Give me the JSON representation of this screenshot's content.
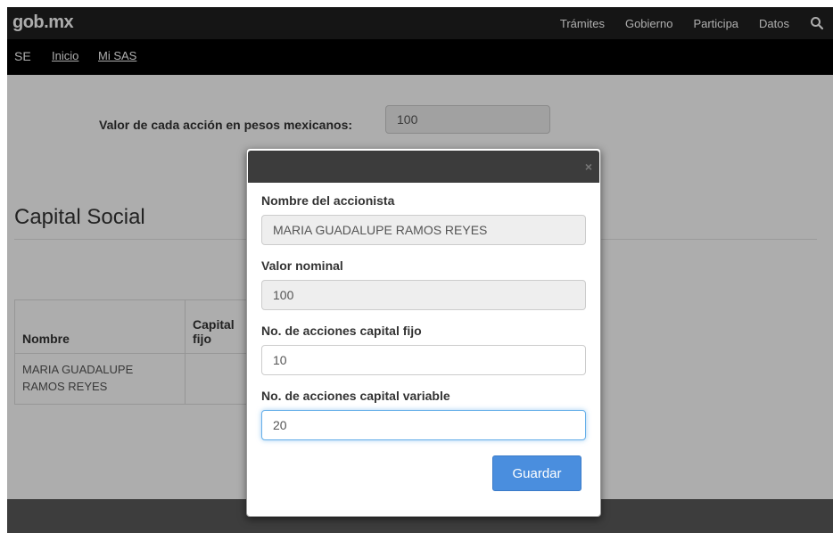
{
  "header": {
    "logo": "gob.mx",
    "nav": [
      "Trámites",
      "Gobierno",
      "Participa",
      "Datos"
    ]
  },
  "subnav": {
    "se": "SE",
    "inicio": "Inicio",
    "mi_sas": "Mi SAS"
  },
  "background": {
    "valor_label": "Valor de cada acción en pesos mexicanos:",
    "valor_value": "100",
    "capital_title": "Capital Social",
    "table": {
      "headers": [
        "Nombre",
        "Capital fijo"
      ],
      "rows": [
        [
          "MARIA GUADALUPE RAMOS REYES",
          ""
        ]
      ]
    }
  },
  "modal": {
    "close": "×",
    "fields": [
      {
        "label": "Nombre del accionista",
        "value": "MARIA GUADALUPE RAMOS REYES"
      },
      {
        "label": "Valor nominal",
        "value": "100"
      },
      {
        "label": "No. de acciones capital fijo",
        "value": "10"
      },
      {
        "label": "No. de acciones capital variable",
        "value": "20"
      }
    ],
    "save_label": "Guardar"
  }
}
